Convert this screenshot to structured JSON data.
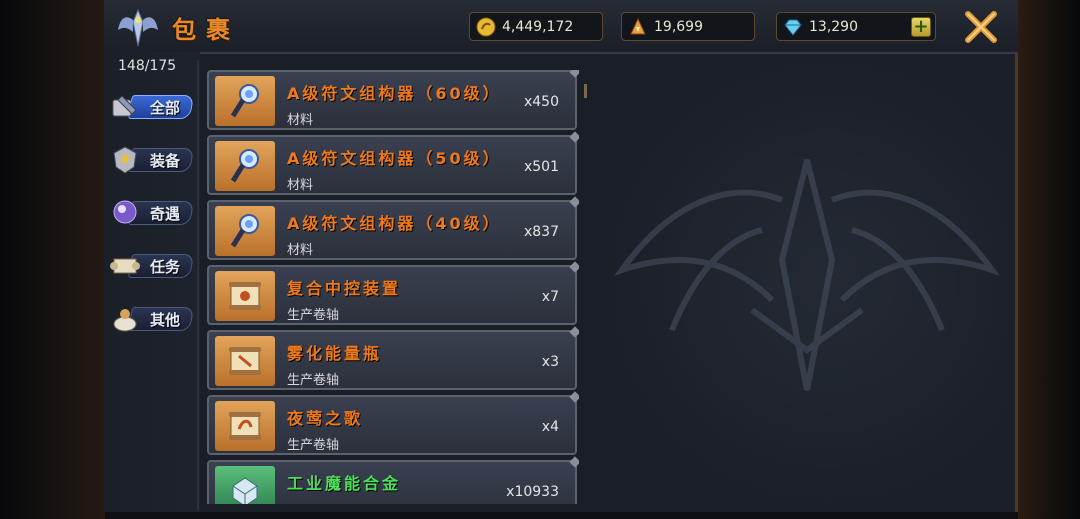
{
  "header": {
    "title": "包裹",
    "resources": [
      {
        "icon": "gold-coin-icon",
        "value": "4,449,172"
      },
      {
        "icon": "energy-crystal-icon",
        "value": "19,699"
      },
      {
        "icon": "diamond-icon",
        "value": "13,290"
      }
    ],
    "add_icon": "plus-icon",
    "close_icon": "close-x-icon"
  },
  "sidebar": {
    "capacity": "148/175",
    "tabs": [
      {
        "label": "全部",
        "icon": "all-items-icon",
        "active": true
      },
      {
        "label": "装备",
        "icon": "equipment-icon",
        "active": false
      },
      {
        "label": "奇遇",
        "icon": "adventure-icon",
        "active": false
      },
      {
        "label": "任务",
        "icon": "quest-scroll-icon",
        "active": false
      },
      {
        "label": "其他",
        "icon": "other-items-icon",
        "active": false
      }
    ]
  },
  "items": [
    {
      "name": "A级符文组构器（60级）",
      "type": "材料",
      "qty": "x450",
      "icon": "rune-constructor-icon",
      "rarity": "orange"
    },
    {
      "name": "A级符文组构器（50级）",
      "type": "材料",
      "qty": "x501",
      "icon": "rune-constructor-icon",
      "rarity": "orange"
    },
    {
      "name": "A级符文组构器（40级）",
      "type": "材料",
      "qty": "x837",
      "icon": "rune-constructor-icon",
      "rarity": "orange"
    },
    {
      "name": "复合中控装置",
      "type": "生产卷轴",
      "qty": "x7",
      "icon": "production-scroll-icon",
      "rarity": "orange"
    },
    {
      "name": "雾化能量瓶",
      "type": "生产卷轴",
      "qty": "x3",
      "icon": "production-scroll-icon",
      "rarity": "orange"
    },
    {
      "name": "夜莺之歌",
      "type": "生产卷轴",
      "qty": "x4",
      "icon": "production-scroll-icon",
      "rarity": "orange"
    },
    {
      "name": "工业魔能合金",
      "type": "",
      "qty": "x10933",
      "icon": "alloy-icon",
      "rarity": "green"
    }
  ],
  "colors": {
    "accent_orange": "#f07a1a",
    "accent_green": "#4ee05a",
    "title_orange": "#e88a2a"
  }
}
